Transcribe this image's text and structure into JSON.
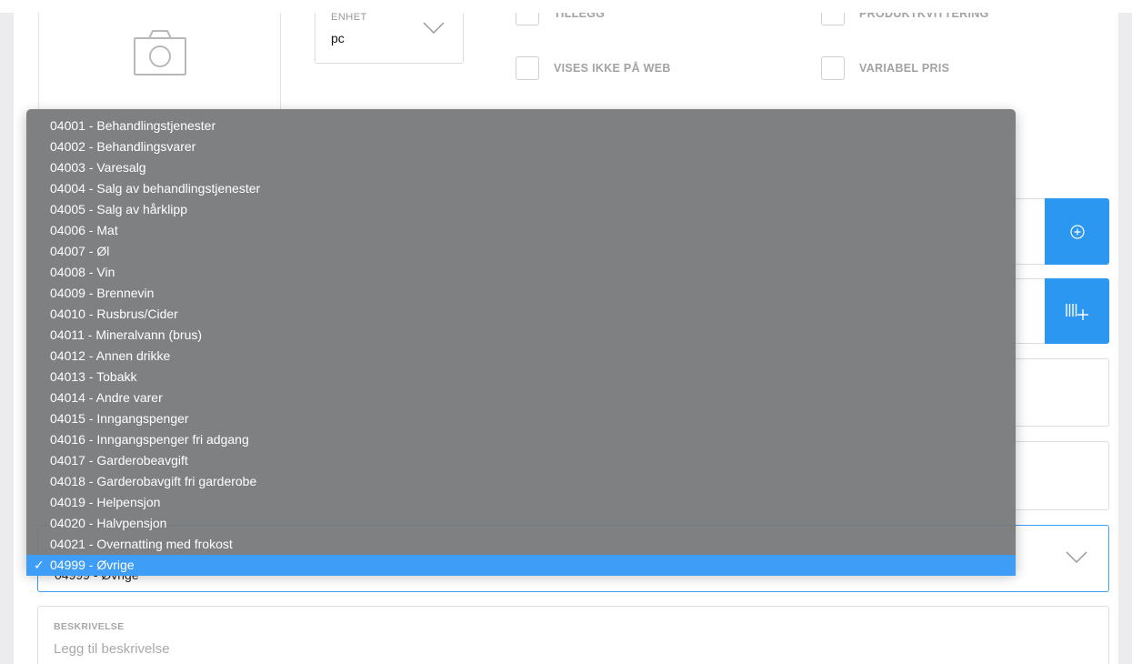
{
  "unit": {
    "label": "ENHET",
    "value": "pc"
  },
  "checkboxes": {
    "tillegg": "TILLEGG",
    "produktkvittering": "PRODUKTKVITTERING",
    "vises_ikke_paa_web": "VISES IKKE PÅ WEB",
    "variabel_pris": "VARIABEL PRIS"
  },
  "dropdown": {
    "options": [
      "04001 - Behandlingstjenester",
      "04002 - Behandlingsvarer",
      "04003 - Varesalg",
      "04004 - Salg av behandlingstjenester",
      "04005 - Salg av hårklipp",
      "04006 - Mat",
      "04007 - Øl",
      "04008 - Vin",
      "04009 - Brennevin",
      "04010 - Rusbrus/Cider",
      "04011 - Mineralvann (brus)",
      "04012 - Annen drikke",
      "04013 - Tobakk",
      "04014 - Andre varer",
      "04015 - Inngangspenger",
      "04016 - Inngangspenger fri adgang",
      "04017 - Garderobeavgift",
      "04018 - Garderobavgift fri garderobe",
      "04019 - Helpensjon",
      "04020 - Halvpensjon",
      "04021 - Overnatting med frokost",
      "04999 - Øvrige"
    ],
    "selected_index": 21,
    "check_mark": "✓"
  },
  "select_field": {
    "value": "04999 - Øvrige"
  },
  "description": {
    "label": "BESKRIVELSE",
    "placeholder": "Legg til beskrivelse"
  },
  "colors": {
    "accent": "#2b97f0",
    "dropdown_bg": "#76787a",
    "selected_bg": "#3e9df7"
  },
  "icons": [
    "camera-icon",
    "chevron-down-icon",
    "add-circle-icon",
    "barcode-add-icon",
    "checkmark-icon"
  ]
}
